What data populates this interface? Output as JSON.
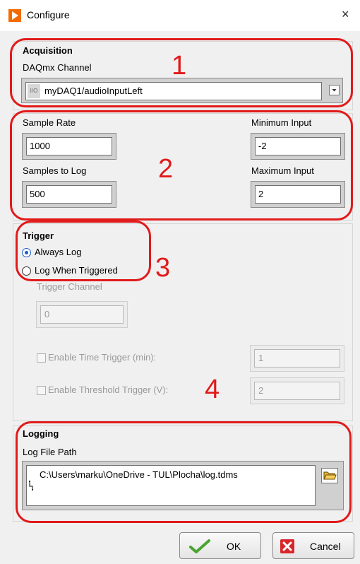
{
  "window": {
    "title": "Configure",
    "close_glyph": "×"
  },
  "acquisition": {
    "title": "Acquisition",
    "channel_label": "DAQmx Channel",
    "channel_value": "myDAQ1/audioInputLeft",
    "channel_icon_text": "I/O"
  },
  "settings": {
    "sample_rate_label": "Sample Rate",
    "sample_rate_value": "1000",
    "samples_to_log_label": "Samples to Log",
    "samples_to_log_value": "500",
    "min_input_label": "Minimum Input",
    "min_input_value": "-2",
    "max_input_label": "Maximum Input",
    "max_input_value": "2"
  },
  "trigger": {
    "title": "Trigger",
    "options": [
      "Always Log",
      "Log When Triggered"
    ],
    "selected": "Always Log",
    "channel_label": "Trigger Channel",
    "channel_value": "0",
    "time_trigger_label": "Enable Time Trigger (min):",
    "time_trigger_value": "1",
    "threshold_trigger_label": "Enable Threshold Trigger (V):",
    "threshold_trigger_value": "2"
  },
  "logging": {
    "title": "Logging",
    "path_label": "Log File Path",
    "path_value": "C:\\Users\\marku\\OneDrive - TUL\\Plocha\\log.tdms"
  },
  "buttons": {
    "ok": "OK",
    "cancel": "Cancel"
  },
  "annotations": [
    "1",
    "2",
    "3",
    "4"
  ],
  "colors": {
    "annotation_red": "#e11a1a",
    "brand_orange": "#f26a00",
    "radio_blue": "#1e5bc6"
  }
}
